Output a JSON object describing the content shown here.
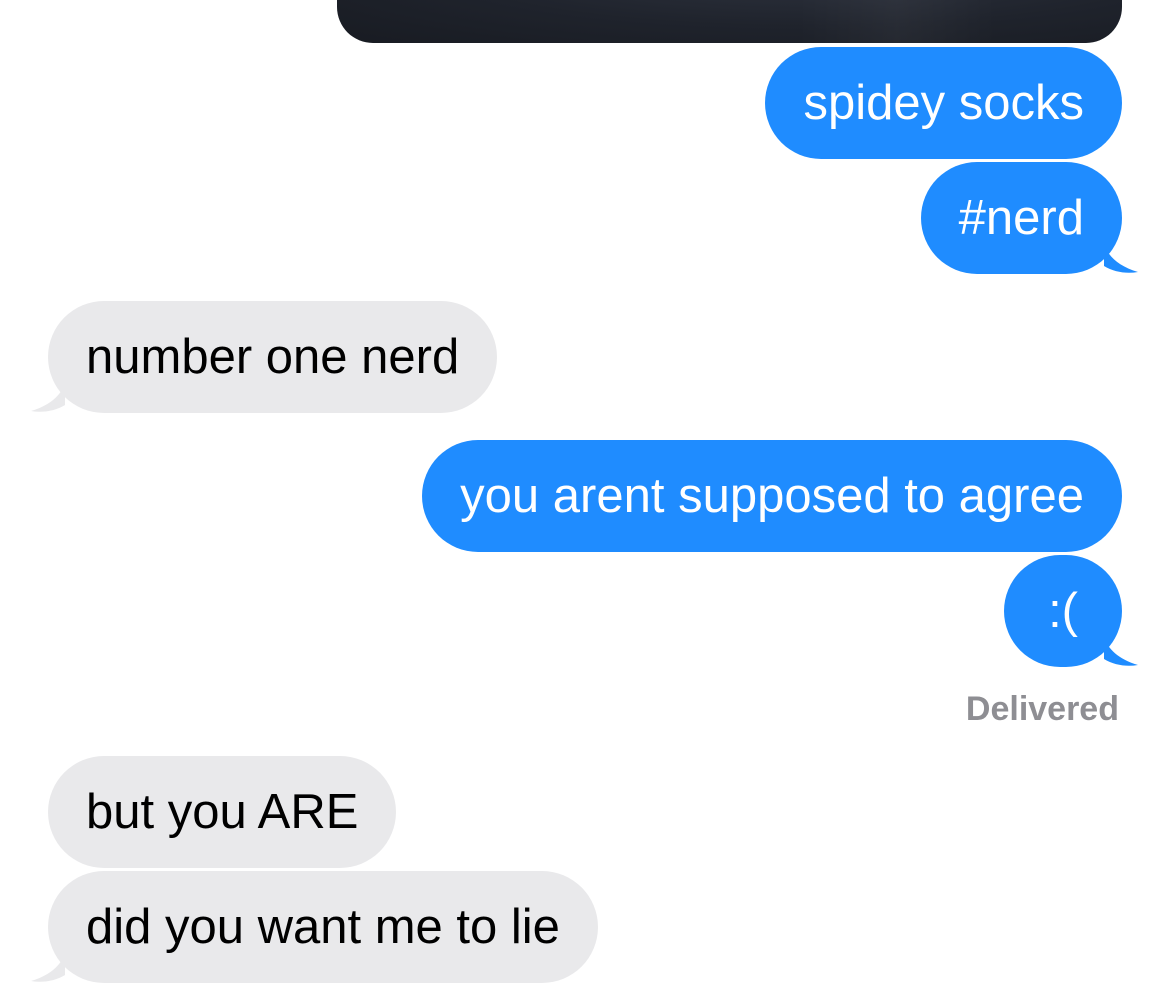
{
  "conversation": {
    "messages": [
      {
        "from": "me",
        "text": "spidey socks"
      },
      {
        "from": "me",
        "text": "#nerd"
      },
      {
        "from": "them",
        "text": "number one nerd"
      },
      {
        "from": "me",
        "text": "you arent supposed to agree"
      },
      {
        "from": "me",
        "text": ":("
      },
      {
        "from": "them",
        "text": "but you ARE"
      },
      {
        "from": "them",
        "text": "did you want me to lie"
      }
    ],
    "status": "Delivered"
  },
  "colors": {
    "sent_bubble": "#1f8cff",
    "received_bubble": "#e9e9eb",
    "status_text": "#8e8e93"
  },
  "icons": {
    "attachment": "photo-thumbnail"
  }
}
